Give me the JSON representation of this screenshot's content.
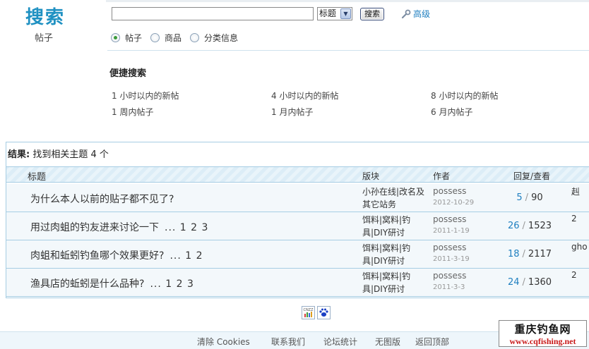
{
  "header": {
    "logo": "搜索",
    "section_label": "帖子",
    "search_value": "",
    "field_select": "标题",
    "search_button": "搜索",
    "advanced_link": "高级"
  },
  "search_types": [
    {
      "label": "帖子",
      "selected": true
    },
    {
      "label": "商品",
      "selected": false
    },
    {
      "label": "分类信息",
      "selected": false
    }
  ],
  "quick_search": {
    "title": "便捷搜索",
    "links": [
      "1 小时以内的新帖",
      "4 小时以内的新帖",
      "8 小时以内的新帖",
      "1 周内帖子",
      "1 月内帖子",
      "6 月内帖子"
    ]
  },
  "results": {
    "label": "结果:",
    "summary": "找到相关主题 4 个",
    "columns": {
      "title": "标题",
      "forum": "版块",
      "author": "作者",
      "stats": "回复/查看"
    },
    "rows": [
      {
        "subject": "为什么本人以前的贴子都不见了?",
        "pages": "",
        "forum": "小孙在线|改名及其它站务",
        "author": "possess",
        "date": "2012-10-29",
        "replies": "5",
        "views": "90",
        "last": "赳"
      },
      {
        "subject": "用过肉蛆的钓友进来讨论一下",
        "pages": "... 1 2 3",
        "forum": "饵料|窝料|钓具|DIY研讨",
        "author": "possess",
        "date": "2011-1-19",
        "replies": "26",
        "views": "1523",
        "last": "2"
      },
      {
        "subject": "肉蛆和蚯蚓钓鱼哪个效果更好?",
        "pages": "... 1 2",
        "forum": "饵料|窝料|钓具|DIY研讨",
        "author": "possess",
        "date": "2011-3-19",
        "replies": "18",
        "views": "2117",
        "last": "gho"
      },
      {
        "subject": "渔具店的蚯蚓是什么品种?",
        "pages": "... 1 2 3",
        "forum": "饵料|窝料|钓具|DIY研讨",
        "author": "possess",
        "date": "2011-3-3",
        "replies": "24",
        "views": "1360",
        "last": "2"
      }
    ]
  },
  "badges": {
    "cnzz": "CNZZ",
    "baidu": "baidu-paw-icon"
  },
  "footer": {
    "links": [
      "清除 Cookies",
      "联系我们",
      "论坛统计",
      "无图版",
      "返回顶部"
    ]
  },
  "watermark": {
    "line1": "重庆钓鱼网",
    "line2": "www.cqfishing.net"
  }
}
